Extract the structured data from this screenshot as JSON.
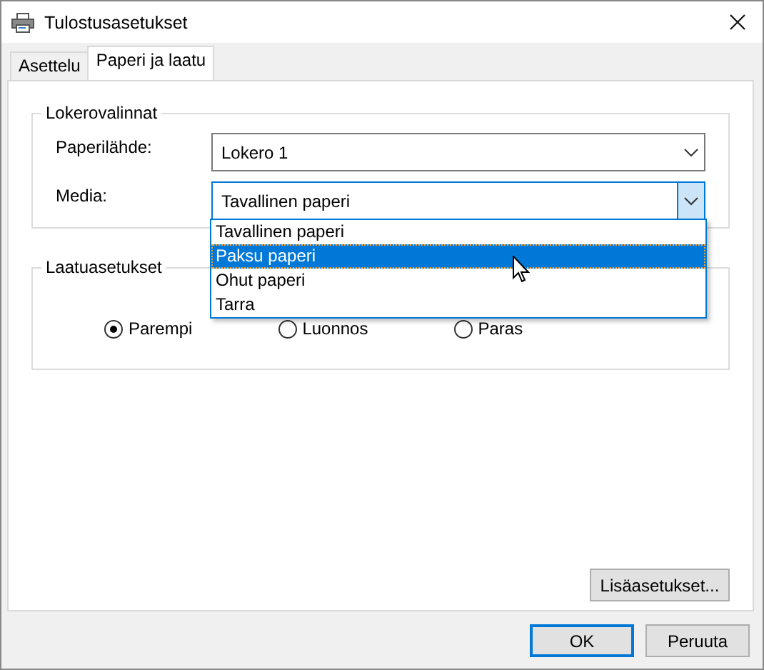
{
  "window": {
    "title": "Tulostusasetukset"
  },
  "tabs": [
    {
      "label": "Asettelu",
      "selected": false
    },
    {
      "label": "Paperi ja laatu",
      "selected": true
    }
  ],
  "tray_group": {
    "title": "Lokerovalinnat",
    "fields": [
      {
        "label": "Paperilähde:",
        "value": "Lokero 1",
        "focused": false
      },
      {
        "label": "Media:",
        "value": "Tavallinen paperi",
        "focused": true
      }
    ]
  },
  "dropdown": {
    "options": [
      {
        "label": "Tavallinen paperi",
        "selected": false
      },
      {
        "label": "Paksu paperi",
        "selected": true
      },
      {
        "label": "Ohut paperi",
        "selected": false
      },
      {
        "label": "Tarra",
        "selected": false
      }
    ]
  },
  "quality_group": {
    "title": "Laatuasetukset",
    "options": [
      {
        "label": "Parempi",
        "selected": true
      },
      {
        "label": "Luonnos",
        "selected": false
      },
      {
        "label": "Paras",
        "selected": false
      }
    ]
  },
  "advanced_button": "Lisäasetukset...",
  "buttons": [
    {
      "label": "OK",
      "default": true
    },
    {
      "label": "Peruuta",
      "default": false
    }
  ]
}
